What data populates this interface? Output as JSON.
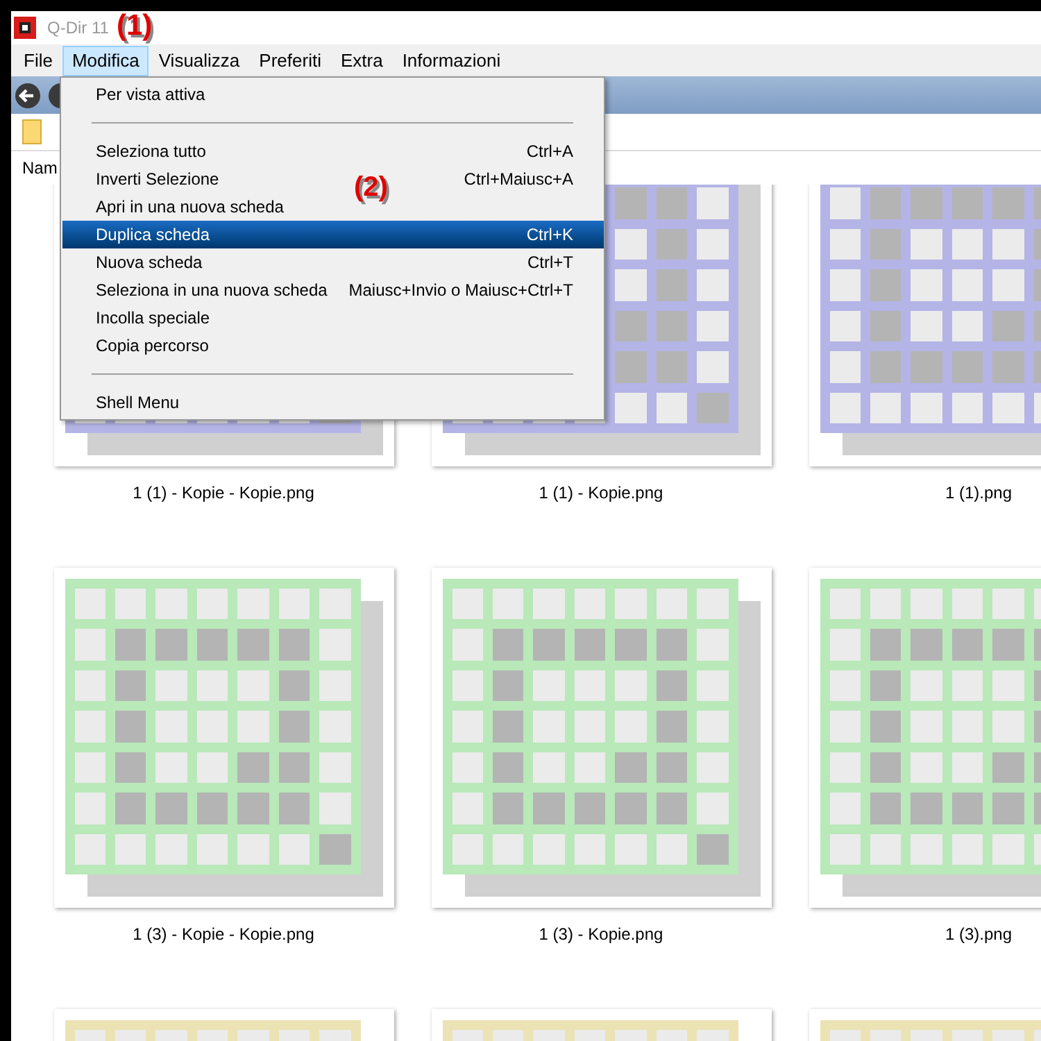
{
  "window": {
    "title": "Q-Dir 11"
  },
  "annotations": [
    {
      "label": "(1)"
    },
    {
      "label": "(2)"
    }
  ],
  "menu_bar": [
    {
      "label": "File",
      "selected": false
    },
    {
      "label": "Modifica",
      "selected": true
    },
    {
      "label": "Visualizza",
      "selected": false
    },
    {
      "label": "Preferiti",
      "selected": false
    },
    {
      "label": "Extra",
      "selected": false
    },
    {
      "label": "Informazioni",
      "selected": false
    }
  ],
  "column_header": "Nam",
  "dropdown_menu": [
    {
      "kind": "item",
      "label": "Per vista attiva",
      "selected": false
    },
    {
      "kind": "separator"
    },
    {
      "kind": "item",
      "label": "Seleziona tutto",
      "shortcut": "Ctrl+A",
      "selected": false
    },
    {
      "kind": "item",
      "label": "Inverti Selezione",
      "shortcut": "Ctrl+Maiusc+A",
      "selected": false
    },
    {
      "kind": "item",
      "label": "Apri in una nuova scheda",
      "selected": false
    },
    {
      "kind": "item",
      "label": "Duplica scheda",
      "shortcut": "Ctrl+K",
      "selected": true
    },
    {
      "kind": "item",
      "label": "Nuova scheda",
      "shortcut": "Ctrl+T",
      "selected": false
    },
    {
      "kind": "item",
      "label": "Seleziona in una nuova scheda",
      "shortcut": "Maiusc+Invio o Maiusc+Ctrl+T",
      "selected": false
    },
    {
      "kind": "item",
      "label": "Incolla speciale",
      "selected": false
    },
    {
      "kind": "item",
      "label": "Copia percorso",
      "selected": false
    },
    {
      "kind": "separator"
    },
    {
      "kind": "item",
      "label": "Shell Menu",
      "selected": false
    }
  ],
  "files": [
    {
      "name": "1 (1) - Kopie - Kopie.png",
      "color": "#b4b4e6"
    },
    {
      "name": "1 (1) - Kopie.png",
      "color": "#b4b4e6"
    },
    {
      "name": "1 (1).png",
      "color": "#b4b4e6"
    },
    {
      "name": "1 (3) - Kopie - Kopie.png",
      "color": "#b9e8b9"
    },
    {
      "name": "1 (3) - Kopie.png",
      "color": "#b9e8b9"
    },
    {
      "name": "1 (3).png",
      "color": "#b9e8b9"
    },
    {
      "color": "#ebe3b4"
    },
    {
      "color": "#ebe3b4"
    },
    {
      "color": "#ebe3b4"
    }
  ]
}
